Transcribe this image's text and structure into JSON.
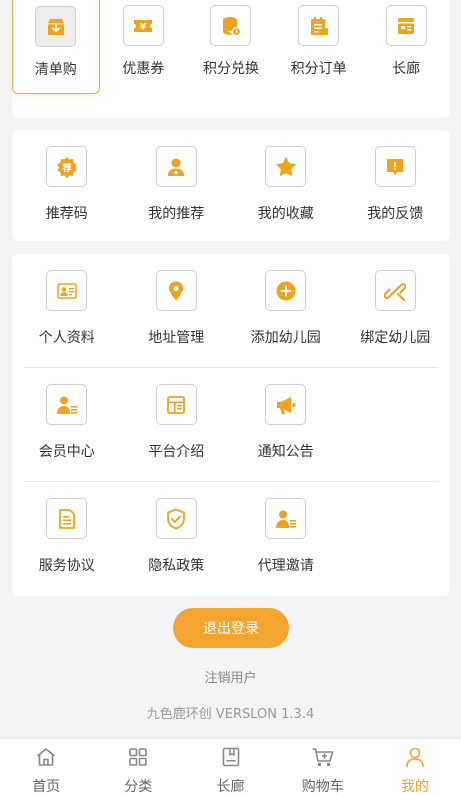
{
  "colors": {
    "accent": "#f3a530",
    "icon": "#f0a31f"
  },
  "top_menu": [
    {
      "label": "清单购",
      "icon": "download-box-icon"
    },
    {
      "label": "优惠券",
      "icon": "coupon-icon"
    },
    {
      "label": "积分兑换",
      "icon": "coin-stack-icon"
    },
    {
      "label": "积分订单",
      "icon": "order-list-icon"
    },
    {
      "label": "长廊",
      "icon": "gallery-icon"
    }
  ],
  "referral_menu": [
    {
      "label": "推荐码",
      "icon": "recommend-badge-icon"
    },
    {
      "label": "我的推荐",
      "icon": "user-add-icon"
    },
    {
      "label": "我的收藏",
      "icon": "star-icon"
    },
    {
      "label": "我的反馈",
      "icon": "feedback-icon"
    }
  ],
  "settings_menu": {
    "row1": [
      {
        "label": "个人资料",
        "icon": "id-card-icon"
      },
      {
        "label": "地址管理",
        "icon": "location-pin-icon"
      },
      {
        "label": "添加幼儿园",
        "icon": "plus-circle-icon"
      },
      {
        "label": "绑定幼儿园",
        "icon": "link-icon"
      }
    ],
    "row2": [
      {
        "label": "会员中心",
        "icon": "member-icon"
      },
      {
        "label": "平台介绍",
        "icon": "platform-icon"
      },
      {
        "label": "通知公告",
        "icon": "megaphone-icon"
      }
    ],
    "row3": [
      {
        "label": "服务协议",
        "icon": "document-icon"
      },
      {
        "label": "隐私政策",
        "icon": "shield-check-icon"
      },
      {
        "label": "代理邀请",
        "icon": "agent-icon"
      }
    ]
  },
  "logout_label": "退出登录",
  "cancel_account_label": "注销用户",
  "version_text": "九色鹿环创 VERSLON 1.3.4",
  "tabbar": [
    {
      "label": "首页",
      "icon": "home-icon",
      "active": false
    },
    {
      "label": "分类",
      "icon": "grid-icon",
      "active": false
    },
    {
      "label": "长廊",
      "icon": "book-icon",
      "active": false
    },
    {
      "label": "购物车",
      "icon": "cart-icon",
      "active": false
    },
    {
      "label": "我的",
      "icon": "user-icon",
      "active": true
    }
  ]
}
